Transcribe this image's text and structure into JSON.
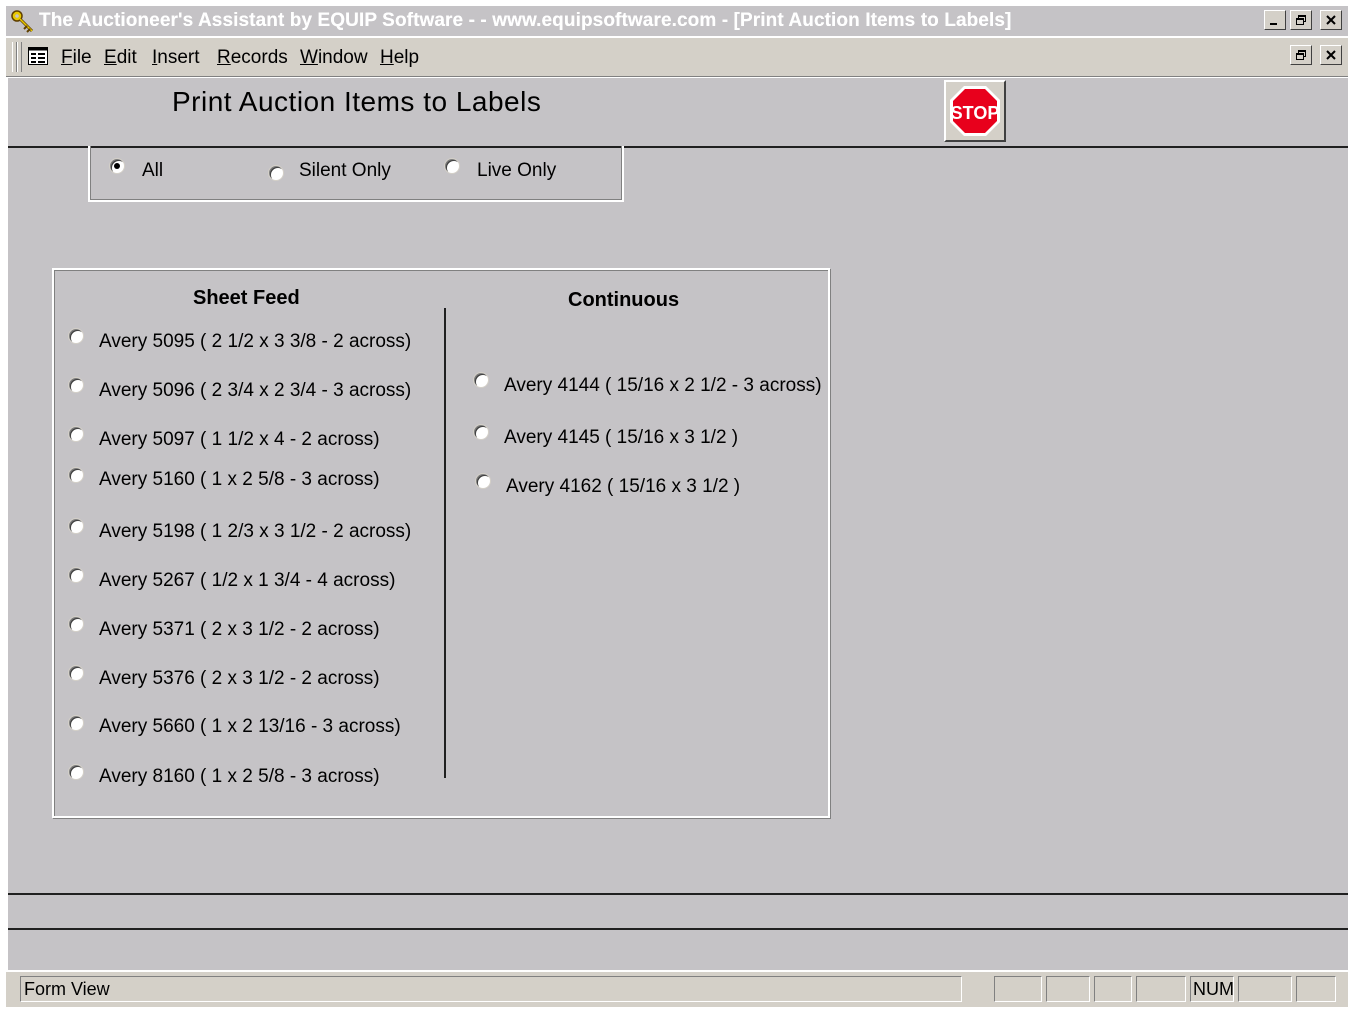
{
  "window": {
    "title": "The Auctioneer's Assistant by EQUIP Software - - www.equipsoftware.com - [Print Auction Items to Labels]",
    "controls": [
      "minimize-icon",
      "restore-icon",
      "close-icon"
    ],
    "title_color": "#ffffff",
    "titlebar_color": "#c5c3c6"
  },
  "menu": {
    "items": [
      {
        "label": "File",
        "underline": "F",
        "rest": "ile"
      },
      {
        "label": "Edit",
        "underline": "E",
        "rest": "dit"
      },
      {
        "label": "Insert",
        "underline": "I",
        "rest": "nsert"
      },
      {
        "label": "Records",
        "underline": "R",
        "rest": "ecords"
      },
      {
        "label": "Window",
        "underline": "W",
        "rest": "indow"
      },
      {
        "label": "Help",
        "underline": "H",
        "rest": "elp"
      }
    ]
  },
  "form": {
    "title": "Print  Auction Items to Labels",
    "stop_label": "STOP",
    "stop_color": "#e8001c",
    "background": "#c5c3c6"
  },
  "filter": {
    "options": [
      {
        "label": "All",
        "checked": true
      },
      {
        "label": "Silent Only",
        "checked": false
      },
      {
        "label": "Live Only",
        "checked": false
      }
    ]
  },
  "labels": {
    "sheet_feed": {
      "heading": "Sheet Feed",
      "options": [
        "Avery 5095 ( 2 1/2 x 3 3/8  - 2 across)",
        "Avery 5096 ( 2 3/4 x 2 3/4  - 3 across)",
        "Avery 5097 ( 1 1/2 x 4   - 2 across)",
        "Avery 5160 ( 1 x  2 5/8  - 3 across)",
        "Avery 5198 ( 1 2/3 x 3 1/2  - 2 across)",
        "Avery 5267 ( 1/2  x 1 3/4  - 4 across)",
        "Avery 5371 ( 2  x 3 1/2  - 2 across)",
        "Avery 5376 ( 2  x 3 1/2  - 2 across)",
        "Avery 5660 ( 1  x 2 13/16  - 3 across)",
        "Avery 8160 ( 1 x  2 5/8  - 3 across)"
      ]
    },
    "continuous": {
      "heading": "Continuous",
      "options": [
        "Avery 4144 ( 15/16 x 2  1/2  - 3 across)",
        "Avery 4145 ( 15/16 x 3 1/2  )",
        "Avery 4162 ( 15/16 x 3 1/2  )"
      ]
    }
  },
  "status": {
    "text": "Form View",
    "num": "NUM"
  }
}
